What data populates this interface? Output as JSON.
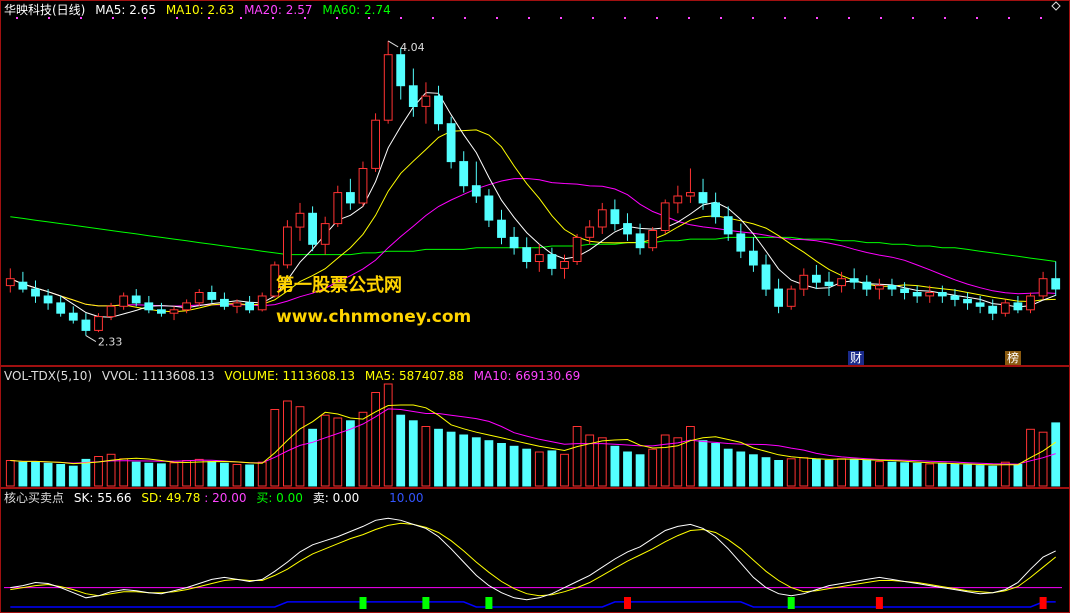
{
  "colors": {
    "background": "#000000",
    "frame": "#a01010",
    "up": "#ff3333",
    "down": "#54ffff",
    "ma5": "#ffffff",
    "ma10": "#ffff00",
    "ma20": "#ff00ff",
    "ma60": "#00ff00",
    "vma10": "#ff00ff",
    "sk": "#ffffff",
    "sd": "#ffff00",
    "level20": "#ff00ff",
    "level10": "#0000ff",
    "buy": "#00ff00",
    "sell": "#ff0000"
  },
  "main_header": {
    "title": "华映科技(日线)",
    "ma5": "MA5: 2.65",
    "ma10": "MA10: 2.63",
    "ma20": "MA20: 2.57",
    "ma60": "MA60: 2.74"
  },
  "high_label": "4.04",
  "low_label": "2.33",
  "watermark": {
    "title": "第一股票公式网",
    "url": "www.chnmoney.com"
  },
  "tags": {
    "cai": "财",
    "bang": "榜"
  },
  "vol_header": {
    "name": "VOL-TDX(5,10)",
    "vvol": "VVOL: 1113608.13",
    "volume": "VOLUME: 1113608.13",
    "ma5": "MA5: 587407.88",
    "ma10": "MA10: 669130.69"
  },
  "ind_header": {
    "name": "核心买卖点",
    "sk": "SK: 55.66",
    "sd": "SD: 49.78",
    "l20": ": 20.00",
    "buy": "买: 0.00",
    "sell": "卖: 0.00",
    "l10": "10.00"
  },
  "chart_data": [
    {
      "type": "candlestick",
      "price_range": [
        2.2,
        4.15
      ],
      "high": 4.04,
      "low": 2.33,
      "last_ma": {
        "MA5": 2.65,
        "MA10": 2.63,
        "MA20": 2.57,
        "MA60": 2.74
      },
      "candles": [
        [
          2.62,
          2.72,
          2.58,
          2.66
        ],
        [
          2.64,
          2.7,
          2.58,
          2.6
        ],
        [
          2.6,
          2.65,
          2.52,
          2.56
        ],
        [
          2.56,
          2.6,
          2.48,
          2.52
        ],
        [
          2.52,
          2.56,
          2.44,
          2.46
        ],
        [
          2.46,
          2.5,
          2.4,
          2.42
        ],
        [
          2.42,
          2.46,
          2.33,
          2.36
        ],
        [
          2.36,
          2.46,
          2.35,
          2.44
        ],
        [
          2.44,
          2.52,
          2.42,
          2.5
        ],
        [
          2.5,
          2.58,
          2.48,
          2.56
        ],
        [
          2.56,
          2.6,
          2.5,
          2.52
        ],
        [
          2.52,
          2.56,
          2.46,
          2.48
        ],
        [
          2.48,
          2.52,
          2.44,
          2.46
        ],
        [
          2.46,
          2.5,
          2.42,
          2.48
        ],
        [
          2.48,
          2.54,
          2.46,
          2.52
        ],
        [
          2.52,
          2.6,
          2.5,
          2.58
        ],
        [
          2.58,
          2.62,
          2.52,
          2.54
        ],
        [
          2.54,
          2.58,
          2.48,
          2.5
        ],
        [
          2.5,
          2.54,
          2.46,
          2.52
        ],
        [
          2.52,
          2.56,
          2.46,
          2.48
        ],
        [
          2.48,
          2.58,
          2.47,
          2.56
        ],
        [
          2.56,
          2.76,
          2.55,
          2.74
        ],
        [
          2.74,
          3.0,
          2.72,
          2.96
        ],
        [
          2.96,
          3.1,
          2.88,
          3.04
        ],
        [
          3.04,
          3.08,
          2.82,
          2.86
        ],
        [
          2.86,
          3.02,
          2.8,
          2.98
        ],
        [
          2.98,
          3.2,
          2.96,
          3.16
        ],
        [
          3.16,
          3.24,
          3.06,
          3.1
        ],
        [
          3.1,
          3.34,
          3.08,
          3.3
        ],
        [
          3.3,
          3.62,
          3.28,
          3.58
        ],
        [
          3.58,
          4.04,
          3.56,
          3.96
        ],
        [
          3.96,
          4.0,
          3.7,
          3.78
        ],
        [
          3.78,
          3.88,
          3.6,
          3.66
        ],
        [
          3.66,
          3.8,
          3.56,
          3.72
        ],
        [
          3.72,
          3.78,
          3.52,
          3.56
        ],
        [
          3.56,
          3.6,
          3.3,
          3.34
        ],
        [
          3.34,
          3.4,
          3.16,
          3.2
        ],
        [
          3.2,
          3.34,
          3.1,
          3.14
        ],
        [
          3.14,
          3.18,
          2.96,
          3.0
        ],
        [
          3.0,
          3.06,
          2.86,
          2.9
        ],
        [
          2.9,
          2.96,
          2.8,
          2.84
        ],
        [
          2.84,
          2.9,
          2.72,
          2.76
        ],
        [
          2.76,
          2.86,
          2.7,
          2.8
        ],
        [
          2.8,
          2.84,
          2.68,
          2.72
        ],
        [
          2.72,
          2.8,
          2.66,
          2.76
        ],
        [
          2.76,
          2.92,
          2.74,
          2.9
        ],
        [
          2.9,
          3.0,
          2.86,
          2.96
        ],
        [
          2.96,
          3.1,
          2.92,
          3.06
        ],
        [
          3.06,
          3.12,
          2.94,
          2.98
        ],
        [
          2.98,
          3.04,
          2.88,
          2.92
        ],
        [
          2.92,
          2.98,
          2.8,
          2.84
        ],
        [
          2.84,
          2.96,
          2.82,
          2.94
        ],
        [
          2.94,
          3.12,
          2.92,
          3.1
        ],
        [
          3.1,
          3.2,
          3.04,
          3.14
        ],
        [
          3.14,
          3.3,
          3.1,
          3.16
        ],
        [
          3.16,
          3.24,
          3.06,
          3.1
        ],
        [
          3.1,
          3.16,
          2.98,
          3.02
        ],
        [
          3.02,
          3.08,
          2.88,
          2.92
        ],
        [
          2.92,
          2.98,
          2.78,
          2.82
        ],
        [
          2.82,
          2.9,
          2.7,
          2.74
        ],
        [
          2.74,
          2.8,
          2.56,
          2.6
        ],
        [
          2.6,
          2.66,
          2.46,
          2.5
        ],
        [
          2.5,
          2.62,
          2.48,
          2.6
        ],
        [
          2.6,
          2.72,
          2.56,
          2.68
        ],
        [
          2.68,
          2.74,
          2.6,
          2.64
        ],
        [
          2.64,
          2.7,
          2.56,
          2.62
        ],
        [
          2.62,
          2.7,
          2.58,
          2.66
        ],
        [
          2.66,
          2.72,
          2.6,
          2.64
        ],
        [
          2.64,
          2.68,
          2.56,
          2.6
        ],
        [
          2.6,
          2.66,
          2.54,
          2.62
        ],
        [
          2.62,
          2.66,
          2.56,
          2.6
        ],
        [
          2.6,
          2.64,
          2.54,
          2.58
        ],
        [
          2.58,
          2.62,
          2.52,
          2.56
        ],
        [
          2.56,
          2.62,
          2.52,
          2.58
        ],
        [
          2.58,
          2.62,
          2.52,
          2.56
        ],
        [
          2.56,
          2.6,
          2.5,
          2.54
        ],
        [
          2.54,
          2.58,
          2.48,
          2.52
        ],
        [
          2.52,
          2.56,
          2.46,
          2.5
        ],
        [
          2.5,
          2.54,
          2.42,
          2.46
        ],
        [
          2.46,
          2.54,
          2.44,
          2.52
        ],
        [
          2.52,
          2.56,
          2.46,
          2.48
        ],
        [
          2.48,
          2.58,
          2.46,
          2.56
        ],
        [
          2.56,
          2.7,
          2.54,
          2.66
        ],
        [
          2.66,
          2.76,
          2.56,
          2.6
        ]
      ],
      "ma60": [
        3.02,
        3.01,
        3.0,
        2.99,
        2.98,
        2.97,
        2.96,
        2.95,
        2.94,
        2.93,
        2.92,
        2.91,
        2.9,
        2.89,
        2.88,
        2.87,
        2.86,
        2.85,
        2.84,
        2.83,
        2.82,
        2.81,
        2.8,
        2.8,
        2.8,
        2.8,
        2.8,
        2.8,
        2.81,
        2.81,
        2.82,
        2.82,
        2.82,
        2.83,
        2.83,
        2.83,
        2.83,
        2.84,
        2.84,
        2.84,
        2.84,
        2.84,
        2.84,
        2.85,
        2.85,
        2.85,
        2.86,
        2.86,
        2.86,
        2.87,
        2.87,
        2.87,
        2.88,
        2.88,
        2.89,
        2.89,
        2.89,
        2.9,
        2.9,
        2.9,
        2.9,
        2.9,
        2.9,
        2.89,
        2.89,
        2.89,
        2.88,
        2.88,
        2.87,
        2.87,
        2.86,
        2.86,
        2.85,
        2.85,
        2.84,
        2.84,
        2.83,
        2.82,
        2.81,
        2.8,
        2.79,
        2.78,
        2.77,
        2.76
      ]
    },
    {
      "type": "bar",
      "name": "VOL-TDX(5,10)",
      "volume_range": [
        0,
        1800000
      ],
      "last": {
        "VOLUME": 1113608.13,
        "MA5": 587407.88,
        "MA10": 669130.69
      },
      "volumes": [
        450000,
        420000,
        430000,
        400000,
        380000,
        350000,
        470000,
        520000,
        560000,
        480000,
        420000,
        400000,
        390000,
        410000,
        450000,
        470000,
        430000,
        400000,
        380000,
        370000,
        420000,
        1350000,
        1500000,
        1400000,
        1000000,
        1250000,
        1200000,
        1150000,
        1300000,
        1650000,
        1800000,
        1250000,
        1150000,
        1050000,
        1000000,
        950000,
        900000,
        850000,
        800000,
        750000,
        700000,
        650000,
        600000,
        620000,
        560000,
        1050000,
        900000,
        850000,
        700000,
        600000,
        550000,
        650000,
        900000,
        850000,
        1050000,
        800000,
        750000,
        650000,
        600000,
        550000,
        500000,
        450000,
        480000,
        500000,
        470000,
        450000,
        480000,
        470000,
        450000,
        430000,
        420000,
        410000,
        400000,
        390000,
        400000,
        380000,
        370000,
        360000,
        350000,
        420000,
        380000,
        1000000,
        950000,
        1113608
      ]
    },
    {
      "type": "line",
      "name": "核心买卖点",
      "y_range": [
        0,
        100
      ],
      "levels": [
        20,
        10
      ],
      "last": {
        "SK": 55.66,
        "SD": 49.78
      },
      "sk": [
        20,
        22,
        25,
        24,
        20,
        15,
        10,
        12,
        16,
        18,
        17,
        15,
        14,
        17,
        20,
        24,
        28,
        30,
        28,
        26,
        28,
        36,
        45,
        55,
        62,
        66,
        70,
        75,
        80,
        86,
        88,
        86,
        82,
        78,
        70,
        58,
        45,
        32,
        22,
        15,
        10,
        8,
        10,
        14,
        20,
        26,
        32,
        40,
        48,
        55,
        60,
        68,
        76,
        80,
        82,
        78,
        70,
        58,
        44,
        30,
        20,
        14,
        12,
        14,
        18,
        22,
        24,
        26,
        28,
        30,
        28,
        26,
        24,
        22,
        20,
        18,
        16,
        14,
        15,
        18,
        25,
        38,
        50,
        56
      ],
      "sd": [
        18,
        20,
        22,
        23,
        21,
        18,
        14,
        12,
        14,
        16,
        16,
        15,
        15,
        16,
        18,
        21,
        24,
        27,
        28,
        27,
        27,
        32,
        38,
        46,
        53,
        58,
        63,
        68,
        72,
        77,
        81,
        83,
        82,
        79,
        74,
        66,
        56,
        45,
        35,
        26,
        19,
        14,
        12,
        13,
        16,
        20,
        25,
        32,
        39,
        46,
        52,
        58,
        65,
        71,
        76,
        77,
        74,
        67,
        58,
        47,
        36,
        27,
        20,
        16,
        17,
        19,
        21,
        23,
        25,
        27,
        27,
        26,
        25,
        23,
        21,
        19,
        17,
        16,
        15,
        17,
        21,
        30,
        40,
        50
      ],
      "signals": [
        {
          "label": "买",
          "index": 28
        },
        {
          "label": "买",
          "index": 33
        },
        {
          "label": "买",
          "index": 38
        },
        {
          "label": "卖",
          "index": 49
        },
        {
          "label": "买",
          "index": 62
        },
        {
          "label": "卖",
          "index": 69
        },
        {
          "label": "卖",
          "index": 82
        }
      ]
    }
  ]
}
